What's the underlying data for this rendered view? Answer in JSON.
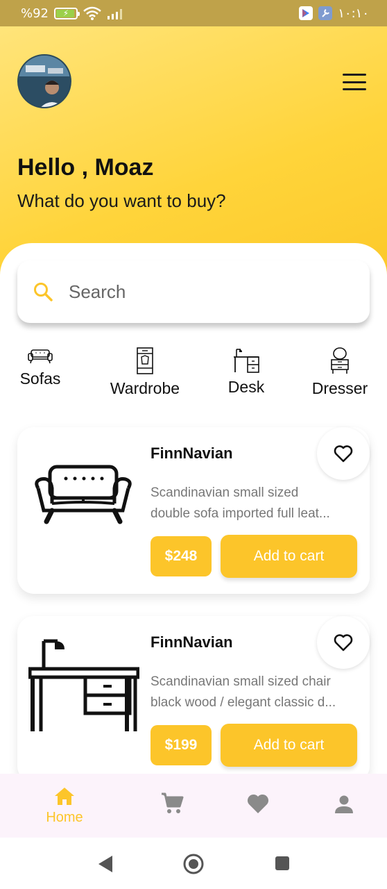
{
  "status_bar": {
    "battery_percent": "%92",
    "time": "١٠:١٠",
    "icons": [
      "battery-charging-icon",
      "wifi-icon",
      "signal-icon",
      "play-store-icon",
      "wrench-icon"
    ]
  },
  "header": {
    "greeting": "Hello , Moaz",
    "subtitle": "What do you want to buy?"
  },
  "search": {
    "placeholder": "Search"
  },
  "categories": [
    {
      "label": "Sofas",
      "icon": "sofa-icon"
    },
    {
      "label": "Wardrobe",
      "icon": "wardrobe-icon"
    },
    {
      "label": "Desk",
      "icon": "desk-icon"
    },
    {
      "label": "Dresser",
      "icon": "dresser-icon"
    }
  ],
  "products": [
    {
      "title": "FinnNavian",
      "desc_line1": "Scandinavian small sized",
      "desc_line2": "double sofa imported full leat...",
      "price": "$248",
      "cart_label": "Add to cart",
      "image": "sofa-image"
    },
    {
      "title": "FinnNavian",
      "desc_line1": "Scandinavian small sized chair",
      "desc_line2": "black wood / elegant classic d...",
      "price": "$199",
      "cart_label": "Add to cart",
      "image": "desk-image"
    }
  ],
  "bottom_nav": [
    {
      "label": "Home",
      "icon": "home-icon",
      "active": true
    },
    {
      "label": "",
      "icon": "cart-icon",
      "active": false
    },
    {
      "label": "",
      "icon": "heart-icon",
      "active": false
    },
    {
      "label": "",
      "icon": "person-icon",
      "active": false
    }
  ],
  "colors": {
    "accent": "#fcc52a",
    "header_gradient_start": "#ffe47a",
    "header_gradient_end": "#fcc92a",
    "inactive_icon": "#8a8a8a",
    "status_bar": "#bfa24a"
  }
}
